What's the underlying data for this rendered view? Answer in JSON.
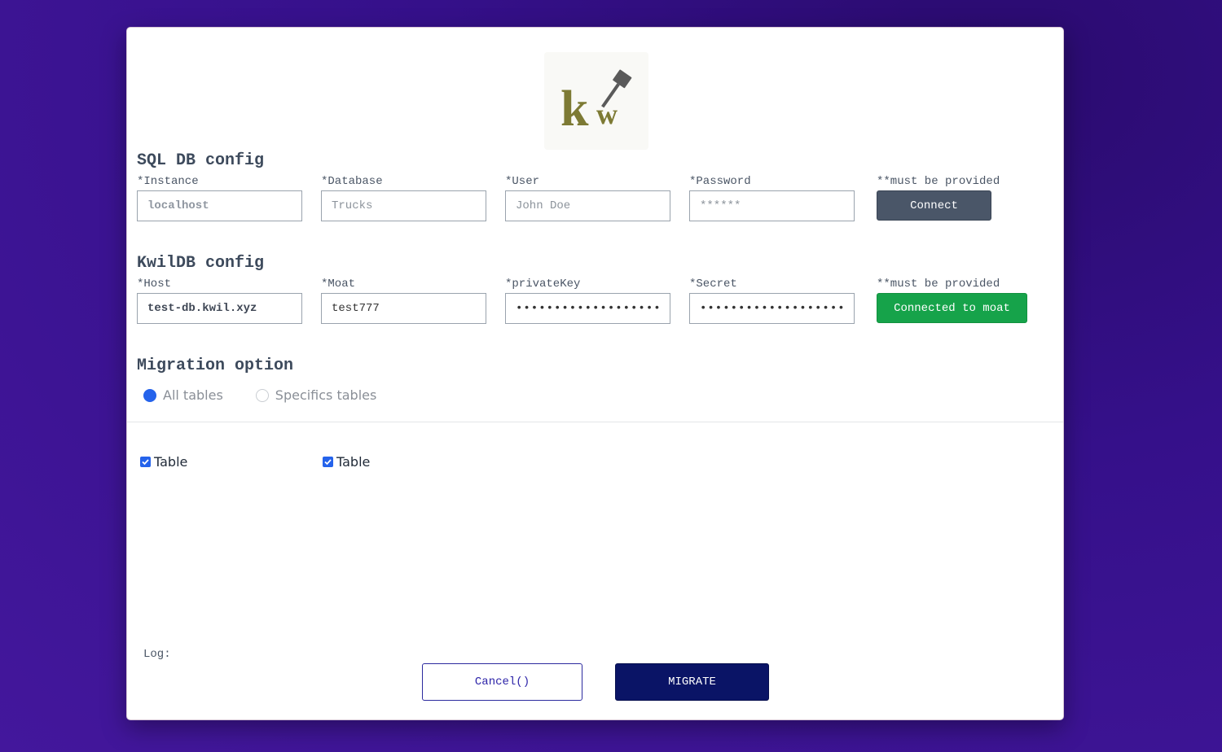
{
  "logo": {
    "text_k": "k",
    "text_w": "w",
    "color": "#7d7a34"
  },
  "sql": {
    "title": "SQL DB config",
    "note": "**must be provided",
    "connect_label": "Connect",
    "fields": [
      {
        "label": "*Instance",
        "placeholder": "localhost",
        "value": ""
      },
      {
        "label": "*Database",
        "placeholder": "Trucks",
        "value": ""
      },
      {
        "label": "*User",
        "placeholder": "John Doe",
        "value": ""
      },
      {
        "label": "*Password",
        "placeholder": "******",
        "value": ""
      }
    ]
  },
  "kwil": {
    "title": "KwilDB config",
    "note": "**must be provided",
    "connected_label": "Connected to moat",
    "fields": [
      {
        "label": "*Host",
        "placeholder": "",
        "value": "test-db.kwil.xyz"
      },
      {
        "label": "*Moat",
        "placeholder": "",
        "value": "test777"
      },
      {
        "label": "*privateKey",
        "placeholder": "",
        "value": "••••••••••••••••••••"
      },
      {
        "label": "*Secret",
        "placeholder": "",
        "value": "••••••••••••••••••••"
      }
    ]
  },
  "migration": {
    "title": "Migration option",
    "options": [
      {
        "label": "All tables",
        "selected": true
      },
      {
        "label": "Specifics tables",
        "selected": false
      }
    ]
  },
  "tables": [
    {
      "label": "Table",
      "checked": true
    },
    {
      "label": "Table",
      "checked": true
    }
  ],
  "log_label": "Log:",
  "buttons": {
    "cancel_label": "Cancel()",
    "migrate_label": "MIGRATE"
  },
  "colors": {
    "background": "#3a128c",
    "connect": "#4a5668",
    "connected": "#16a34a",
    "migrate": "#0a1466",
    "radio_selected": "#2563eb"
  }
}
